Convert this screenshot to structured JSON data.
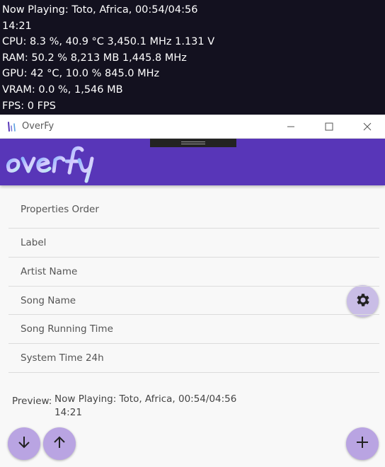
{
  "overlay": {
    "lines": [
      "Now Playing: Toto, Africa, 00:54/04:56",
      "14:21",
      "CPU: 8.3 %, 40.9 °C 3,450.1 MHz 1.131 V",
      "RAM: 50.2 % 8,213 MB 1,445.8 MHz",
      "GPU: 42 °C, 10.0 % 845.0 MHz",
      "VRAM: 0.0 %, 1,546 MB",
      "FPS: 0 FPS"
    ]
  },
  "window": {
    "title": "OverFy",
    "icons": {
      "app": "app-icon",
      "minimize": "minimize-icon",
      "maximize": "maximize-icon",
      "close": "close-icon"
    }
  },
  "header": {
    "logo_text": "overfy",
    "settings_icon": "gear-icon",
    "accent_color": "#5836b8"
  },
  "properties": {
    "heading": "Properties Order",
    "items": [
      "Label",
      "Artist Name",
      "Song Name",
      "Song Running Time",
      "System Time 24h"
    ]
  },
  "preview": {
    "label": "Preview:",
    "line1": "Now Playing: Toto, Africa, 00:54/04:56",
    "line2": "14:21"
  },
  "actions": {
    "move_down_icon": "arrow-down-icon",
    "move_up_icon": "arrow-up-icon",
    "add_icon": "plus-icon",
    "button_color": "#b9a4e2"
  }
}
